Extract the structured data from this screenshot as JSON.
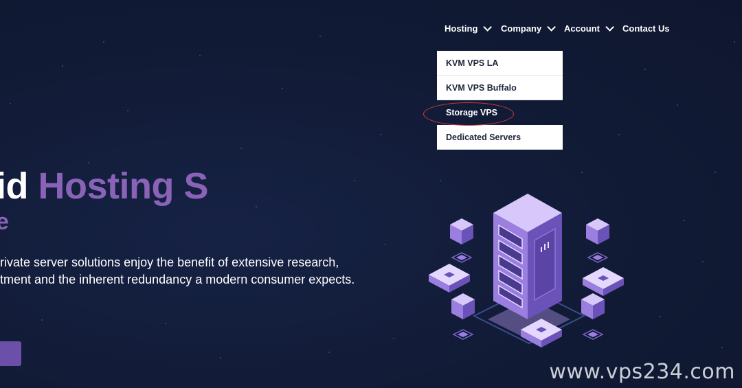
{
  "nav": {
    "items": [
      {
        "label": "Hosting",
        "has_dropdown": true
      },
      {
        "label": "Company",
        "has_dropdown": true
      },
      {
        "label": "Account",
        "has_dropdown": true
      },
      {
        "label": "Contact Us",
        "has_dropdown": false
      }
    ]
  },
  "dropdown": {
    "items": [
      {
        "label": "KVM VPS LA"
      },
      {
        "label": "KVM VPS Buffalo"
      },
      {
        "label": "Storage VPS"
      },
      {
        "label": "Dedicated Servers"
      }
    ],
    "highlighted_item": "Storage VPS"
  },
  "hero": {
    "title_white": "id ",
    "title_accent": "Hosting S",
    "subtitle": "e",
    "desc_line1": "rivate server solutions enjoy the benefit of extensive research,",
    "desc_line2": "tment and the inherent redundancy a modern consumer expects."
  },
  "watermark": "www.vps234.com",
  "colors": {
    "background": "#131c38",
    "accent_purple": "#8a63b8",
    "button_purple": "#6b4fa8",
    "annotation_red": "#d23a3a",
    "dropdown_bg": "#ffffff"
  },
  "icons": {
    "chevron": "chevron-down-icon",
    "illustration": "server-rack-illustration"
  }
}
